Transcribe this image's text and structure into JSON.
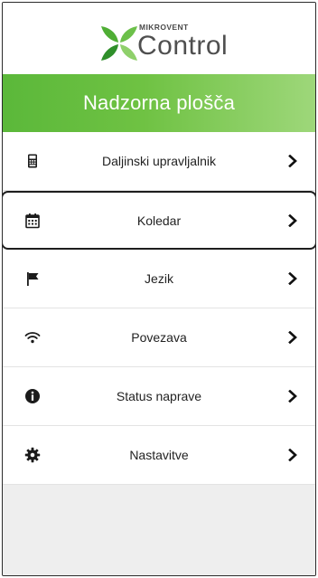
{
  "logo": {
    "brand": "MIKROVENT",
    "product": "Control"
  },
  "header": {
    "title": "Nadzorna plošča"
  },
  "menu": {
    "items": [
      {
        "label": "Daljinski upravljalnik",
        "icon": "remote-control-icon"
      },
      {
        "label": "Koledar",
        "icon": "calendar-icon",
        "selected": true
      },
      {
        "label": "Jezik",
        "icon": "flag-icon"
      },
      {
        "label": "Povezava",
        "icon": "wifi-icon"
      },
      {
        "label": "Status naprave",
        "icon": "info-icon"
      },
      {
        "label": "Nastavitve",
        "icon": "gear-icon"
      }
    ]
  },
  "colors": {
    "accent": "#6fc243",
    "header_gradient_end": "#9ed77a",
    "text": "#222222"
  }
}
